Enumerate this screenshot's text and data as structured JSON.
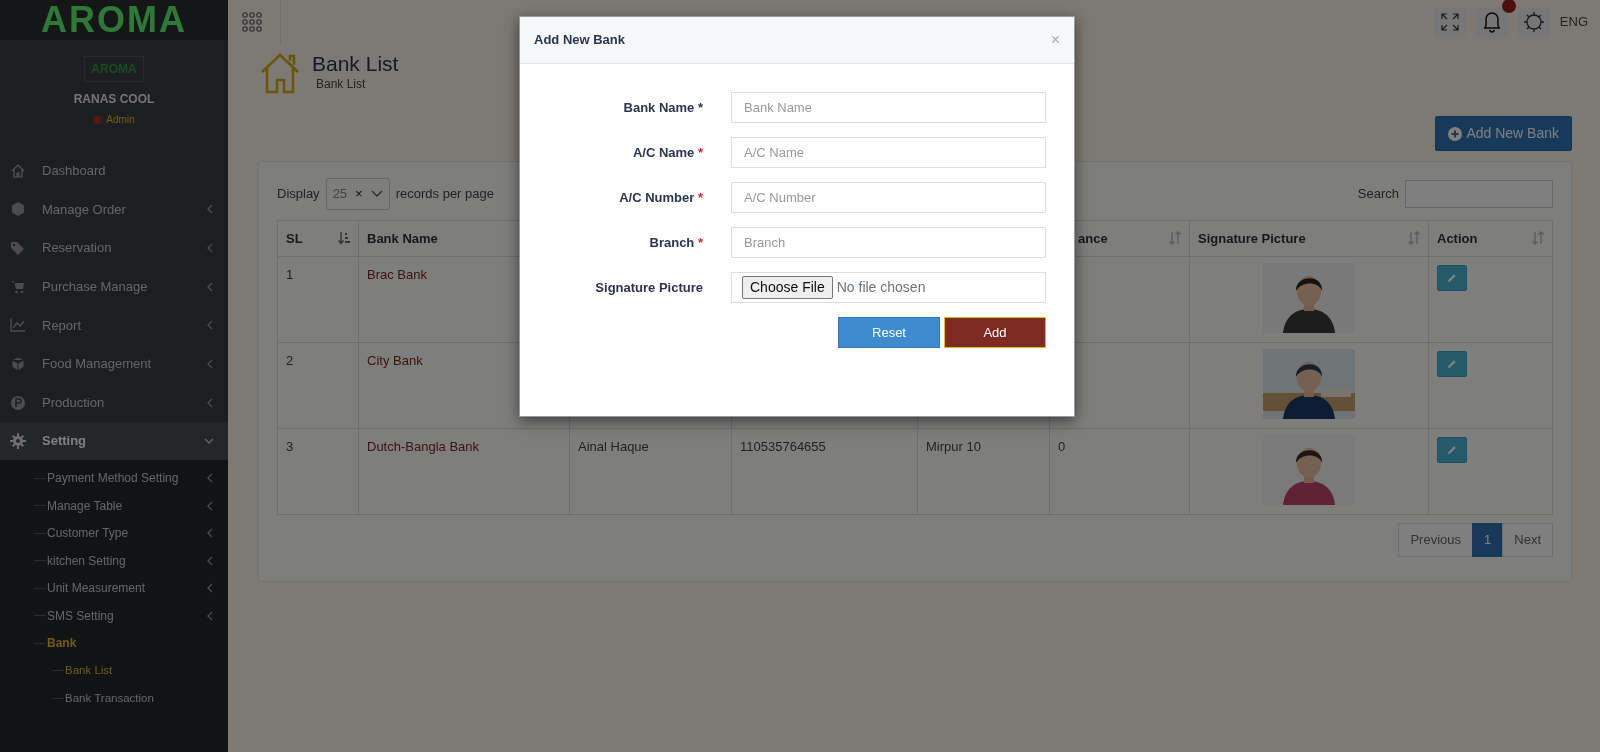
{
  "brand": {
    "logo": "AROMA"
  },
  "profile": {
    "logo": "AROMA",
    "name": "RANAS COOL",
    "role": "Admin"
  },
  "sidebar": {
    "items": [
      {
        "label": "Dashboard",
        "kind": "link",
        "selected": false
      },
      {
        "label": "Manage Order",
        "kind": "menu",
        "selected": false,
        "expanded": false
      },
      {
        "label": "Reservation",
        "kind": "menu",
        "selected": false,
        "expanded": false
      },
      {
        "label": "Purchase Manage",
        "kind": "menu",
        "selected": false,
        "expanded": false
      },
      {
        "label": "Report",
        "kind": "menu",
        "selected": false,
        "expanded": false
      },
      {
        "label": "Food Management",
        "kind": "menu",
        "selected": false,
        "expanded": false
      },
      {
        "label": "Production",
        "kind": "menu",
        "selected": false,
        "expanded": false
      },
      {
        "label": "Setting",
        "kind": "menu",
        "selected": true,
        "expanded": true,
        "children": [
          {
            "label": "Payment Method Setting",
            "kind": "menu",
            "selected": false,
            "expanded": false
          },
          {
            "label": "Manage Table",
            "kind": "menu",
            "selected": false,
            "expanded": false
          },
          {
            "label": "Customer Type",
            "kind": "menu",
            "selected": false,
            "expanded": false
          },
          {
            "label": "kitchen Setting",
            "kind": "menu",
            "selected": false,
            "expanded": false
          },
          {
            "label": "Unit Measurement",
            "kind": "menu",
            "selected": false,
            "expanded": false
          },
          {
            "label": "SMS Setting",
            "kind": "menu",
            "selected": false,
            "expanded": false
          },
          {
            "label": "Bank",
            "kind": "group",
            "selected": true,
            "expanded": true,
            "children": [
              {
                "label": "Bank List",
                "kind": "link",
                "selected": true
              },
              {
                "label": "Bank Transaction",
                "kind": "link",
                "selected": false
              }
            ]
          }
        ]
      }
    ]
  },
  "topbar": {
    "language": "ENG"
  },
  "page": {
    "title": "Bank List",
    "breadcrumb": "Bank List",
    "add_button": "Add New Bank"
  },
  "table_controls": {
    "display_label": "Display",
    "page_size": "25",
    "clear": "×",
    "records_label": "records per page",
    "search_label": "Search"
  },
  "table": {
    "columns": [
      {
        "label": "SL",
        "sorted": true
      },
      {
        "label": "Bank Name"
      },
      null,
      null,
      null,
      {
        "label": "ance",
        "sorted": false
      },
      {
        "label": "Signature Picture",
        "sorted": false
      },
      {
        "label": "Action",
        "sorted": false
      }
    ],
    "rows": [
      {
        "cells": [
          "1",
          "Brac Bank",
          null,
          null,
          null,
          null
        ]
      },
      {
        "cells": [
          "2",
          "City Bank",
          null,
          null,
          null,
          null
        ]
      },
      {
        "cells": [
          "3",
          "Dutch-Bangla Bank",
          "Ainal Haque",
          "110535764655",
          "Mirpur 10",
          "0"
        ]
      }
    ]
  },
  "pagination": [
    {
      "label": "Previous",
      "selected": false
    },
    {
      "label": "1",
      "selected": true
    },
    {
      "label": "Next",
      "selected": false
    }
  ],
  "modal": {
    "title": "Add New Bank",
    "close": "×",
    "fields": [
      {
        "kind": "text",
        "label": "Bank Name *",
        "placeholder": "Bank Name"
      },
      {
        "kind": "text",
        "label": "A/C Name",
        "required": true,
        "required_mark": "*",
        "placeholder": "A/C Name"
      },
      {
        "kind": "text",
        "label": "A/C Number",
        "required": true,
        "required_mark": "*",
        "placeholder": "A/C Number"
      },
      {
        "kind": "text",
        "label": "Branch",
        "required": true,
        "required_mark": "*",
        "placeholder": "Branch"
      },
      {
        "kind": "file",
        "label": "Signature Picture",
        "button": "Choose File",
        "status": "No file chosen"
      }
    ],
    "buttons": [
      {
        "label": "Reset",
        "kind": "reset"
      },
      {
        "label": "Add",
        "kind": "submit"
      }
    ]
  }
}
